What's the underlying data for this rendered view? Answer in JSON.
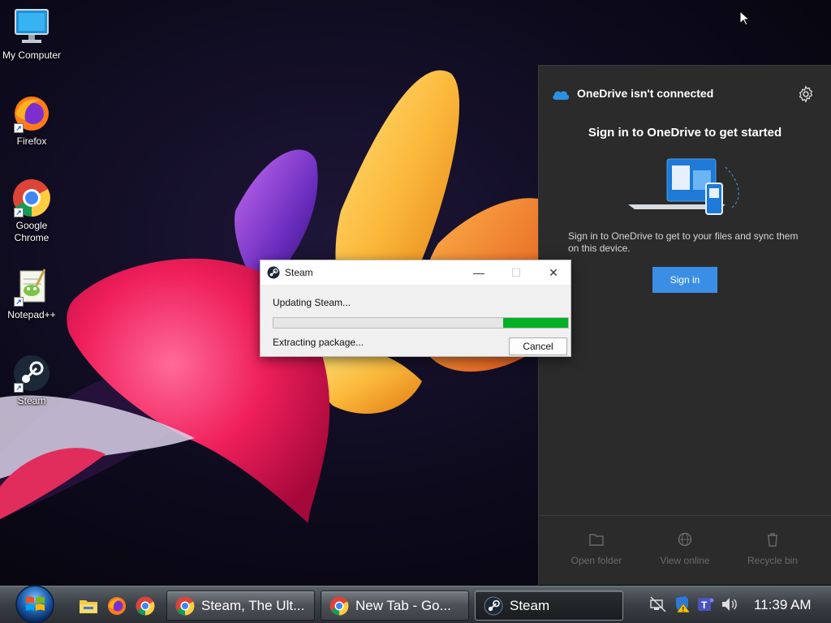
{
  "desktop": {
    "icons": [
      {
        "label": "My Computer",
        "icon": "computer-icon"
      },
      {
        "label": "Firefox",
        "icon": "firefox-icon"
      },
      {
        "label": "Google Chrome",
        "icon": "chrome-icon"
      },
      {
        "label": "Notepad++",
        "icon": "notepadpp-icon"
      },
      {
        "label": "Steam",
        "icon": "steam-icon"
      }
    ]
  },
  "onedrive": {
    "title": "OneDrive isn't connected",
    "heading": "Sign in to OneDrive to get started",
    "description": "Sign in to OneDrive to get to your files and sync them on this device.",
    "signin_label": "Sign in",
    "footer": [
      {
        "label": "Open folder",
        "icon": "folder-icon"
      },
      {
        "label": "View online",
        "icon": "globe-icon"
      },
      {
        "label": "Recycle bin",
        "icon": "trash-icon"
      }
    ],
    "accent": "#3a8ee6"
  },
  "steam_dialog": {
    "title": "Steam",
    "status": "Updating Steam...",
    "substatus": "Extracting package...",
    "cancel_label": "Cancel",
    "progress_fraction": 0.22,
    "progress_color": "#06b025",
    "controls": {
      "minimize": "—",
      "maximize": "☐",
      "close": "✕"
    }
  },
  "taskbar": {
    "pinned": [
      "file-explorer-icon",
      "firefox-icon",
      "chrome-icon"
    ],
    "windows": [
      {
        "label": "Steam, The Ult...",
        "icon": "chrome-icon"
      },
      {
        "label": "New Tab - Go...",
        "icon": "chrome-icon"
      },
      {
        "label": "Steam",
        "icon": "steam-icon",
        "active": true
      }
    ],
    "tray": [
      "network-off-icon",
      "security-warning-icon",
      "teams-icon",
      "volume-icon"
    ],
    "clock": "11:39 AM"
  }
}
